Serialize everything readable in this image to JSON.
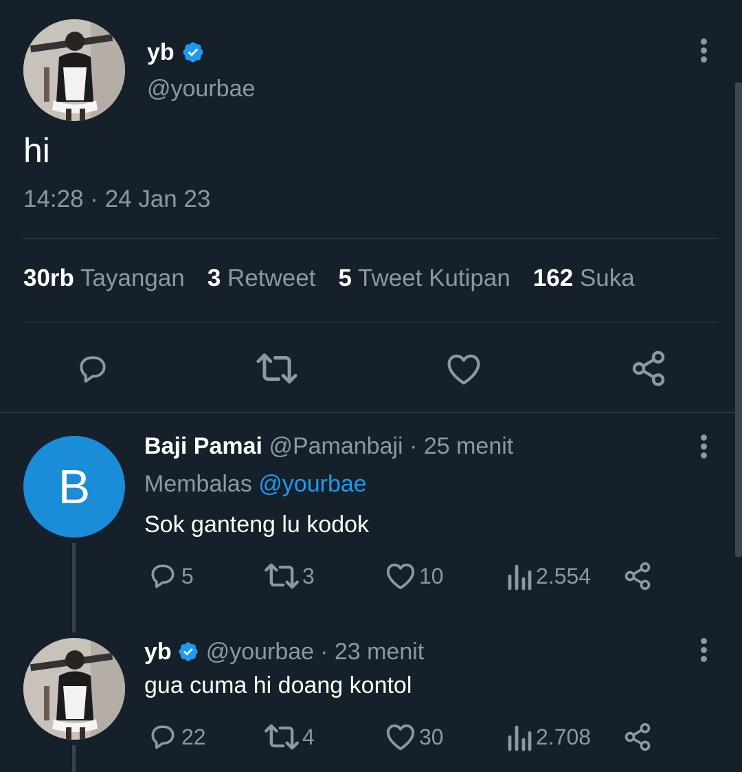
{
  "main_tweet": {
    "author_name": "yb",
    "author_handle": "@yourbae",
    "text": "hi",
    "timestamp": "14:28 · 24 Jan 23",
    "stats": [
      {
        "value": "30rb",
        "label": "Tayangan"
      },
      {
        "value": "3",
        "label": "Retweet"
      },
      {
        "value": "5",
        "label": "Tweet Kutipan"
      },
      {
        "value": "162",
        "label": "Suka"
      }
    ]
  },
  "replies": [
    {
      "author_name": "Baji Pamai",
      "author_handle": "@Pamanbaji",
      "time": "· 25 menit",
      "avatar_letter": "B",
      "reply_to_prefix": "Membalas",
      "reply_to_handle": "@yourbae",
      "text": "Sok ganteng lu kodok",
      "replies": "5",
      "retweets": "3",
      "likes": "10",
      "views": "2.554"
    },
    {
      "author_name": "yb",
      "author_handle": "@yourbae",
      "time": "· 23 menit",
      "text": "gua cuma hi doang kontol",
      "replies": "22",
      "retweets": "4",
      "likes": "30",
      "views": "2.708"
    }
  ],
  "icons": [
    "verified-badge-icon",
    "more-icon",
    "reply-icon",
    "retweet-icon",
    "like-icon",
    "share-icon",
    "views-icon"
  ],
  "colors": {
    "background": "#15202b",
    "muted": "#8b98a5",
    "accent": "#1d9bf0",
    "divider": "#38444d",
    "avatar_b": "#1a8cd8"
  }
}
